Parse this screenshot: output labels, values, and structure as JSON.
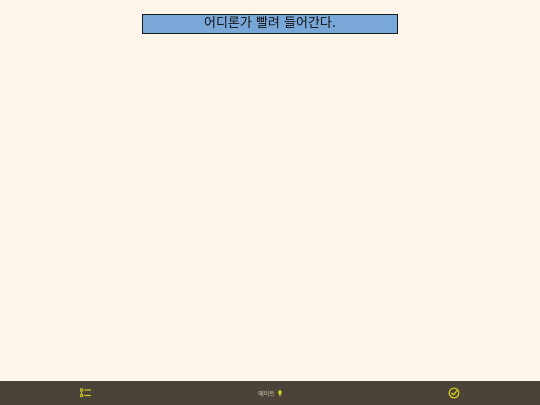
{
  "narration": {
    "text": "어디론가 빨려 들어간다."
  },
  "bottom_bar": {
    "title": "에이트",
    "menu_icon": "list-icon",
    "title_icon": "pin-icon",
    "confirm_icon": "check-circle-icon"
  },
  "colors": {
    "background": "#fdf5ea",
    "narration_box": "#79a8d8",
    "bottom_bar": "#4b4338",
    "icon_accent": "#d9d21e"
  }
}
